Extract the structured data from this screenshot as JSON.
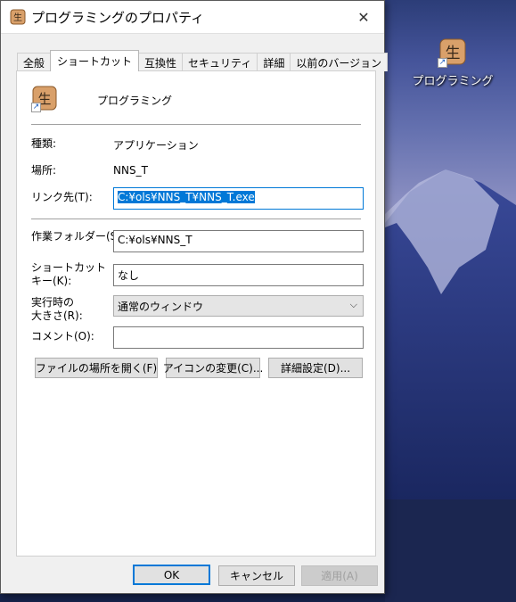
{
  "window": {
    "title": "プログラミングのプロパティ",
    "close_glyph": "✕"
  },
  "tabs": [
    {
      "label": "全般"
    },
    {
      "label": "ショートカット"
    },
    {
      "label": "互換性"
    },
    {
      "label": "セキュリティ"
    },
    {
      "label": "詳細"
    },
    {
      "label": "以前のバージョン"
    }
  ],
  "shortcut": {
    "name": "プログラミング",
    "type_label": "種類:",
    "type_value": "アプリケーション",
    "location_label": "場所:",
    "location_value": "NNS_T",
    "target_label": "リンク先(T):",
    "target_value": "C:¥ols¥NNS_T¥NNS_T.exe",
    "workdir_label": "作業フォルダー(S):",
    "workdir_value": "C:¥ols¥NNS_T",
    "hotkey_label_1": "ショートカット",
    "hotkey_label_2": "キー(K):",
    "hotkey_value": "なし",
    "run_label_1": "実行時の",
    "run_label_2": "大きさ(R):",
    "run_value": "通常のウィンドウ",
    "comment_label": "コメント(O):",
    "comment_value": ""
  },
  "action_buttons": {
    "open_location": "ファイルの場所を開く(F)",
    "change_icon": "アイコンの変更(C)...",
    "advanced": "詳細設定(D)..."
  },
  "footer_buttons": {
    "ok": "OK",
    "cancel": "キャンセル",
    "apply": "適用(A)"
  },
  "desktop": {
    "icon_label": "プログラミング"
  },
  "colors": {
    "accent": "#0078d7",
    "icon_fill": "#d9a06a"
  }
}
